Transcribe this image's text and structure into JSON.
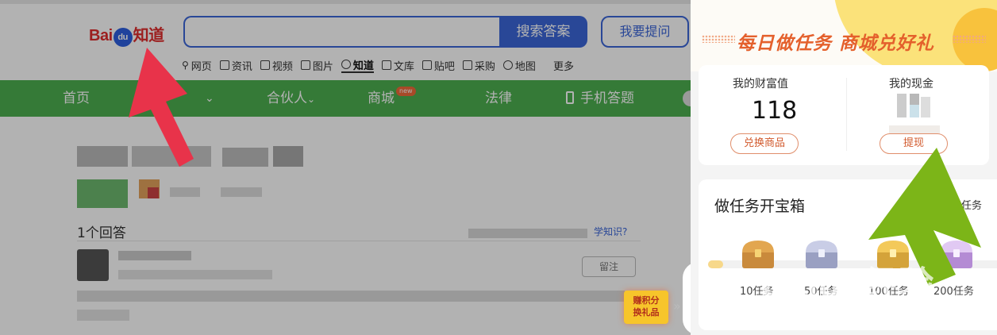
{
  "header": {
    "logo_bai": "Bai",
    "logo_du": "du",
    "logo_zhidao": "知道",
    "search_value": "",
    "search_button": "搜索答案",
    "ask_button": "我要提问"
  },
  "subnav": [
    {
      "label": "网页",
      "icon": "search-icon"
    },
    {
      "label": "资讯",
      "icon": "news-icon"
    },
    {
      "label": "视频",
      "icon": "video-icon"
    },
    {
      "label": "图片",
      "icon": "image-icon"
    },
    {
      "label": "知道",
      "icon": "question-icon",
      "active": true
    },
    {
      "label": "文库",
      "icon": "doc-icon"
    },
    {
      "label": "贴吧",
      "icon": "tieba-icon"
    },
    {
      "label": "采购",
      "icon": "shop-icon"
    },
    {
      "label": "地图",
      "icon": "map-icon"
    },
    {
      "label": "更多",
      "icon": ""
    }
  ],
  "mainnav": {
    "home": "首页",
    "partner": "合伙人",
    "mall": "商城",
    "mall_tag": "new",
    "law": "法律",
    "mobile": "手机答题"
  },
  "content": {
    "answer_count": "1个回答",
    "learn_link": "学知识?",
    "follow": "留注",
    "reward_line1": "赚积分",
    "reward_line2": "换礼品",
    "expand": "»"
  },
  "panel": {
    "banner_text": "每日做任务  商城兑好礼",
    "wealth_label": "我的财富值",
    "wealth_value": "118",
    "exchange_button": "兑换商品",
    "cash_label": "我的现金",
    "withdraw_button": "提现",
    "task_title": "做任务开宝箱",
    "task_right": "个任务",
    "task_progress": 0.05,
    "milestones": [
      "10任务",
      "50任务",
      "100任务",
      "200任务"
    ]
  },
  "watermark": {
    "text": "Baidu经验",
    "url": "jingyan.baidu.com"
  },
  "colors": {
    "brand_blue": "#3b66d8",
    "nav_green": "#4caf50",
    "banner_orange": "#e4602c",
    "red_arrow": "#e8334a",
    "green_arrow": "#7cb518"
  }
}
